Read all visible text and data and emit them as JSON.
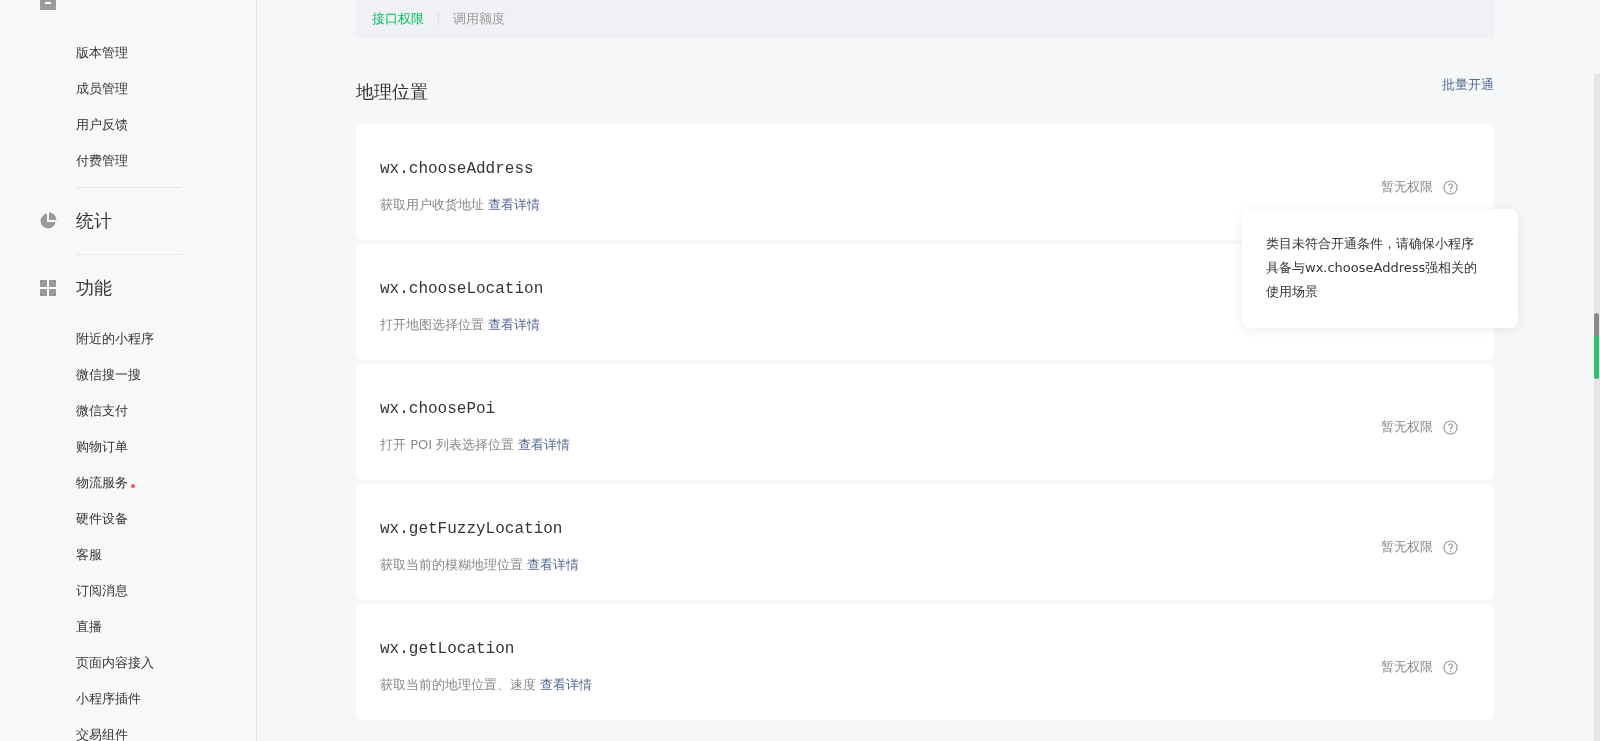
{
  "sidebar": {
    "groups": [
      {
        "items": [
          {
            "label": "版本管理",
            "dot": false
          },
          {
            "label": "成员管理",
            "dot": false
          },
          {
            "label": "用户反馈",
            "dot": false
          },
          {
            "label": "付费管理",
            "dot": false
          }
        ]
      },
      {
        "title": "统计"
      },
      {
        "title": "功能",
        "items": [
          {
            "label": "附近的小程序",
            "dot": false
          },
          {
            "label": "微信搜一搜",
            "dot": false
          },
          {
            "label": "微信支付",
            "dot": false
          },
          {
            "label": "购物订单",
            "dot": false
          },
          {
            "label": "物流服务",
            "dot": true
          },
          {
            "label": "硬件设备",
            "dot": false
          },
          {
            "label": "客服",
            "dot": false
          },
          {
            "label": "订阅消息",
            "dot": false
          },
          {
            "label": "直播",
            "dot": false
          },
          {
            "label": "页面内容接入",
            "dot": false
          },
          {
            "label": "小程序插件",
            "dot": false
          },
          {
            "label": "交易组件",
            "dot": false
          }
        ]
      }
    ]
  },
  "tabs": [
    {
      "label": "接口权限",
      "selected": true
    },
    {
      "label": "调用额度",
      "selected": false
    }
  ],
  "section": {
    "title": "地理位置",
    "action": "批量开通"
  },
  "apis": [
    {
      "name": "wx.chooseAddress",
      "description": "获取用户收货地址",
      "link": "查看详情",
      "status": "暂无权限"
    },
    {
      "name": "wx.chooseLocation",
      "description": "打开地图选择位置",
      "link": "查看详情"
    },
    {
      "name": "wx.choosePoi",
      "description": "打开 POI 列表选择位置",
      "link": "查看详情",
      "status": "暂无权限"
    },
    {
      "name": "wx.getFuzzyLocation",
      "description": "获取当前的模糊地理位置",
      "link": "查看详情",
      "status": "暂无权限"
    },
    {
      "name": "wx.getLocation",
      "description": "获取当前的地理位置、速度",
      "link": "查看详情",
      "status": "暂无权限"
    }
  ],
  "tooltip": {
    "lines": [
      "类目未符合开通条件，请确保小程序",
      "具备与wx.chooseAddress强相关的",
      "使用场景"
    ]
  }
}
